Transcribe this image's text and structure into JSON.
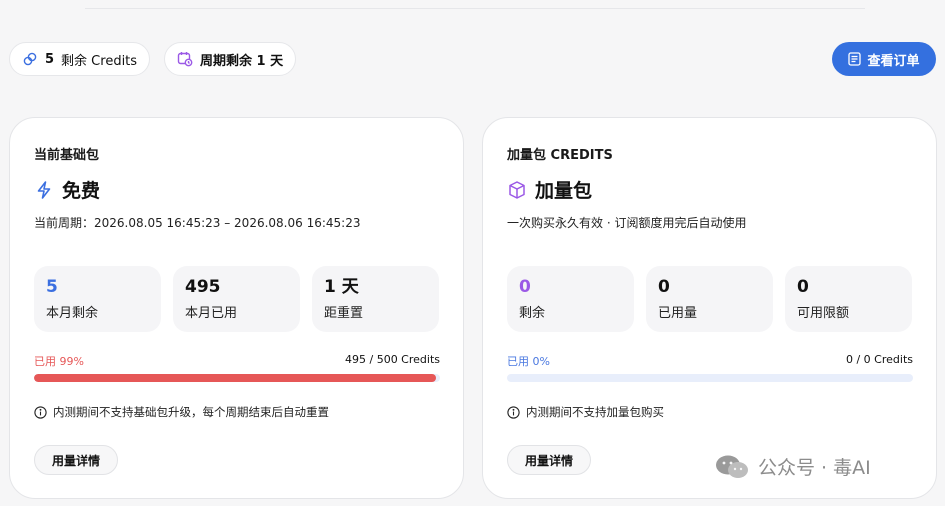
{
  "header": {
    "credits_pill": {
      "count": "5",
      "label": "剩余 Credits"
    },
    "cycle_pill": {
      "label": "周期剩余 1 天"
    },
    "orders_button": {
      "label": "查看订单"
    }
  },
  "base_card": {
    "eyebrow": "当前基础包",
    "title": "免费",
    "period": "当前周期：2026.08.05 16:45:23 – 2026.08.06 16:45:23",
    "stats": [
      {
        "value": "5",
        "label": "本月剩余"
      },
      {
        "value": "495",
        "label": "本月已用"
      },
      {
        "value": "1 天",
        "label": "距重置"
      }
    ],
    "usage_label": "已用 99%",
    "usage_total": "495 / 500 Credits",
    "usage_fraction": 0.99,
    "note": "内测期间不支持基础包升级，每个周期结束后自动重置",
    "detail_button": "用量详情"
  },
  "addon_card": {
    "eyebrow": "加量包 CREDITS",
    "title": "加量包",
    "description": "一次购买永久有效 · 订阅额度用完后自动使用",
    "stats": [
      {
        "value": "0",
        "label": "剩余"
      },
      {
        "value": "0",
        "label": "已用量"
      },
      {
        "value": "0",
        "label": "可用限额"
      }
    ],
    "usage_label": "已用 0%",
    "usage_total": "0 / 0 Credits",
    "usage_fraction": 0.0,
    "note": "内测期间不支持加量包购买",
    "detail_button": "用量详情"
  },
  "watermark": "公众号 · 毒AI",
  "colors": {
    "accent_blue": "#3470df",
    "stat_blue": "#3b6fe0",
    "stat_purple": "#9b59e6",
    "usage_red": "#e65757",
    "usage_blue": "#4a78e0",
    "bar_track": "#e8eefb"
  },
  "icons": {
    "credits": "coins-icon",
    "cycle": "calendar-clock-icon",
    "orders": "document-icon",
    "base": "lightning-icon",
    "addon": "package-icon",
    "info": "info-icon",
    "wechat": "wechat-icon"
  }
}
